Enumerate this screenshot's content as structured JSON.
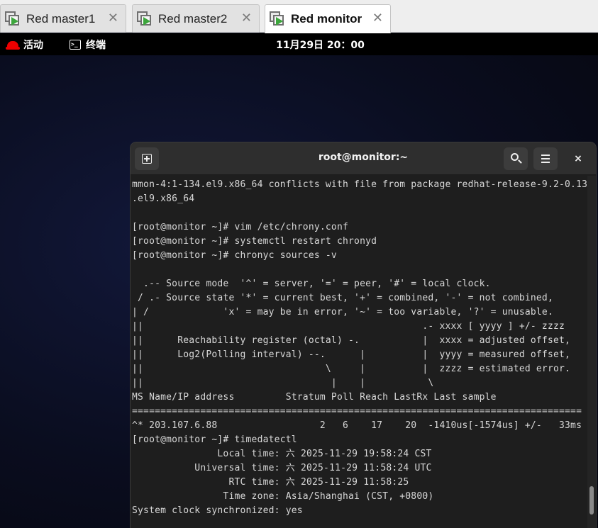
{
  "tabs": [
    {
      "label": "Red master1",
      "close": "✕"
    },
    {
      "label": "Red master2",
      "close": "✕"
    },
    {
      "label": "Red monitor",
      "close": "✕"
    }
  ],
  "topbar": {
    "activities": "活动",
    "app": "终端",
    "clock": "11月29日  20：00"
  },
  "terminal": {
    "title": "root@monitor:~",
    "close": "×",
    "lines": [
      "mmon-4:1-134.el9.x86_64 conflicts with file from package redhat-release-9.2-0.13",
      ".el9.x86_64",
      "",
      "[root@monitor ~]# vim /etc/chrony.conf",
      "[root@monitor ~]# systemctl restart chronyd",
      "[root@monitor ~]# chronyc sources -v",
      "",
      "  .-- Source mode  '^' = server, '=' = peer, '#' = local clock.",
      " / .- Source state '*' = current best, '+' = combined, '-' = not combined,",
      "| /             'x' = may be in error, '~' = too variable, '?' = unusable.",
      "||                                                 .- xxxx [ yyyy ] +/- zzzz",
      "||      Reachability register (octal) -.           |  xxxx = adjusted offset,",
      "||      Log2(Polling interval) --.      |          |  yyyy = measured offset,",
      "||                                \\     |          |  zzzz = estimated error.",
      "||                                 |    |           \\",
      "MS Name/IP address         Stratum Poll Reach LastRx Last sample",
      "===============================================================================",
      "^* 203.107.6.88                  2   6    17    20  -1410us[-1574us] +/-   33ms",
      "[root@monitor ~]# timedatectl",
      "               Local time: 六 2025-11-29 19:58:24 CST",
      "           Universal time: 六 2025-11-29 11:58:24 UTC",
      "                 RTC time: 六 2025-11-29 11:58:25",
      "                Time zone: Asia/Shanghai (CST, +0800)",
      "System clock synchronized: yes"
    ]
  }
}
